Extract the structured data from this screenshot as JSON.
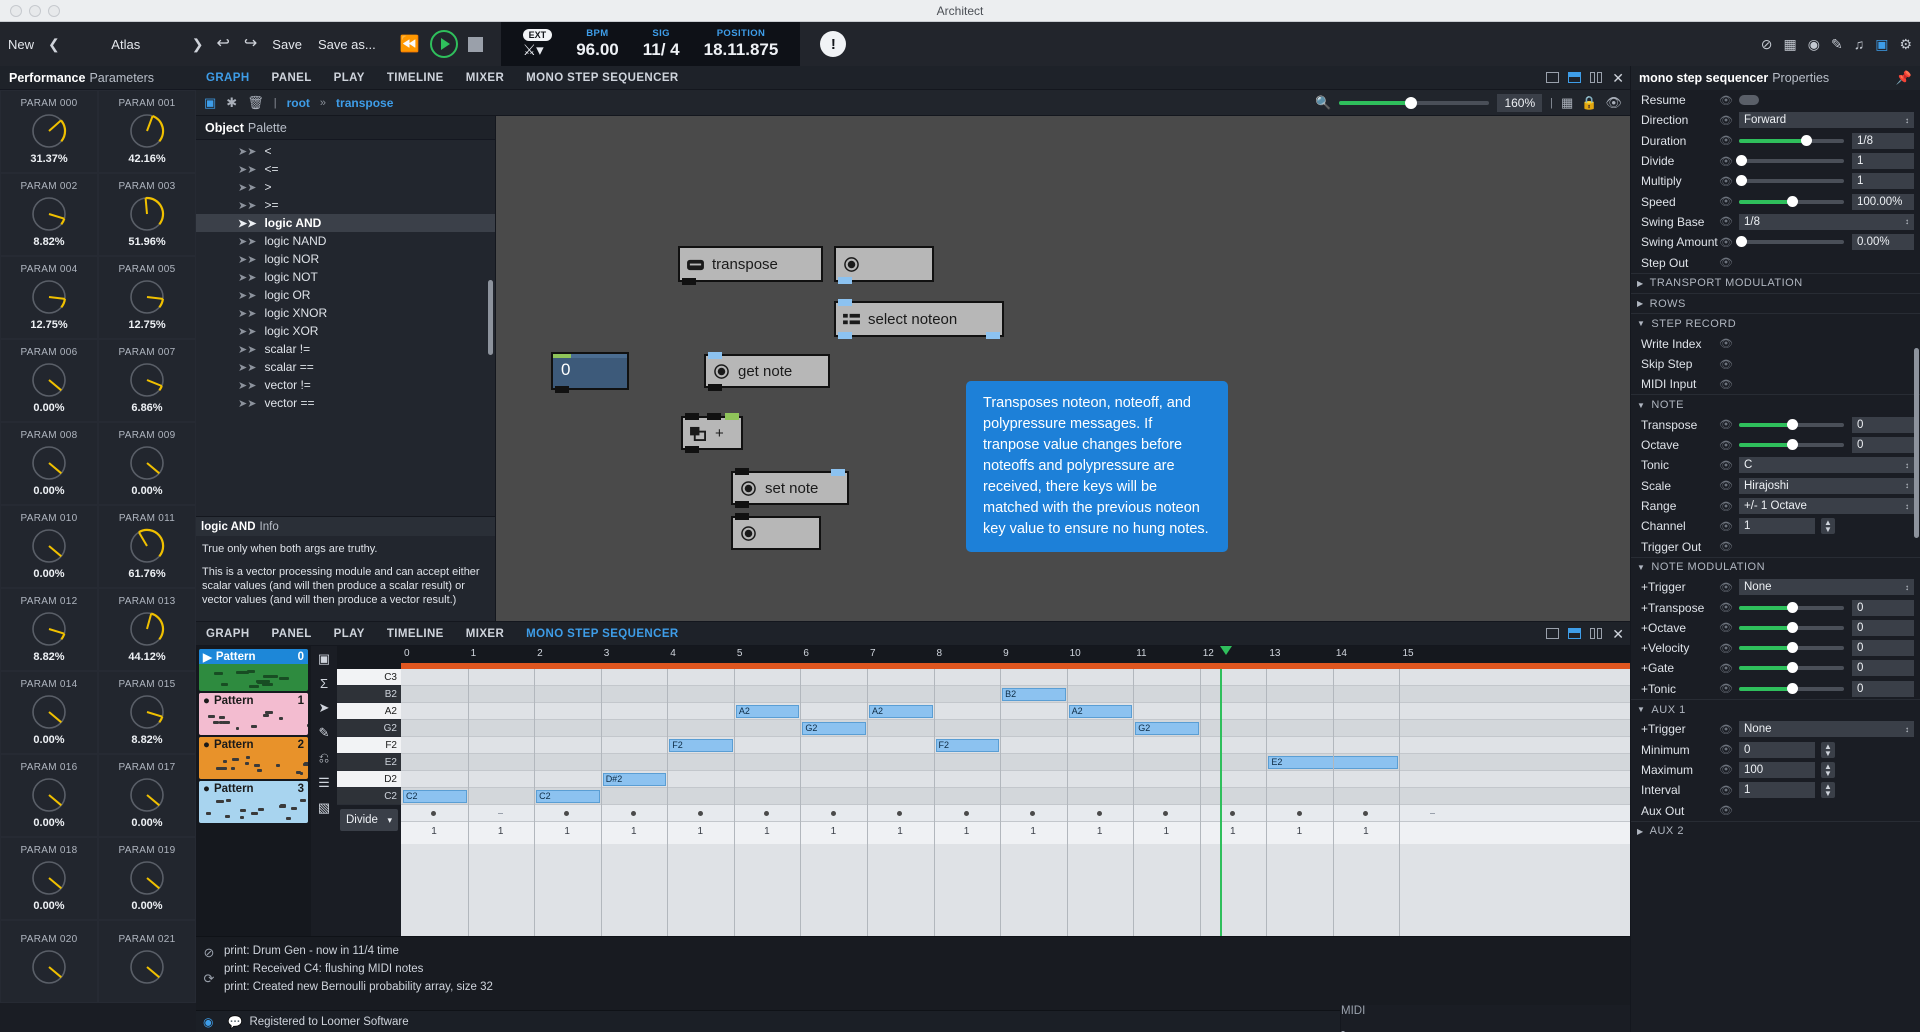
{
  "window": {
    "title": "Architect"
  },
  "toolbar": {
    "new_label": "New",
    "project": "Atlas",
    "save_label": "Save",
    "save_as_label": "Save as...",
    "ext_badge": "EXT",
    "bpm_label": "BPM",
    "bpm_value": "96.00",
    "sig_label": "SIG",
    "sig_num": "11/",
    "sig_den": "4",
    "position_label": "POSITION",
    "position_value": "18.11.875",
    "accent": "#3e9de8",
    "play_color": "#2fbf5c"
  },
  "left_panel": {
    "title_bold": "Performance",
    "title_rest": "Parameters",
    "params": [
      {
        "name": "PARAM 000",
        "value": "31.37%",
        "pct": 31.37
      },
      {
        "name": "PARAM 001",
        "value": "42.16%",
        "pct": 42.16
      },
      {
        "name": "PARAM 002",
        "value": "8.82%",
        "pct": 8.82
      },
      {
        "name": "PARAM 003",
        "value": "51.96%",
        "pct": 51.96
      },
      {
        "name": "PARAM 004",
        "value": "12.75%",
        "pct": 12.75
      },
      {
        "name": "PARAM 005",
        "value": "12.75%",
        "pct": 12.75
      },
      {
        "name": "PARAM 006",
        "value": "0.00%",
        "pct": 0
      },
      {
        "name": "PARAM 007",
        "value": "6.86%",
        "pct": 6.86
      },
      {
        "name": "PARAM 008",
        "value": "0.00%",
        "pct": 0
      },
      {
        "name": "PARAM 009",
        "value": "0.00%",
        "pct": 0
      },
      {
        "name": "PARAM 010",
        "value": "0.00%",
        "pct": 0
      },
      {
        "name": "PARAM 011",
        "value": "61.76%",
        "pct": 61.76
      },
      {
        "name": "PARAM 012",
        "value": "8.82%",
        "pct": 8.82
      },
      {
        "name": "PARAM 013",
        "value": "44.12%",
        "pct": 44.12
      },
      {
        "name": "PARAM 014",
        "value": "0.00%",
        "pct": 0
      },
      {
        "name": "PARAM 015",
        "value": "8.82%",
        "pct": 8.82
      },
      {
        "name": "PARAM 016",
        "value": "0.00%",
        "pct": 0
      },
      {
        "name": "PARAM 017",
        "value": "0.00%",
        "pct": 0
      },
      {
        "name": "PARAM 018",
        "value": "0.00%",
        "pct": 0
      },
      {
        "name": "PARAM 019",
        "value": "0.00%",
        "pct": 0
      },
      {
        "name": "PARAM 020",
        "value": "",
        "pct": 0
      },
      {
        "name": "PARAM 021",
        "value": "",
        "pct": 0
      }
    ]
  },
  "editor_tabs": {
    "items": [
      "GRAPH",
      "PANEL",
      "PLAY",
      "TIMELINE",
      "MIXER",
      "MONO STEP SEQUENCER"
    ],
    "active": "GRAPH"
  },
  "graph_bar": {
    "breadcrumb_root": "root",
    "breadcrumb_sep": "»",
    "breadcrumb_current": "transpose",
    "zoom_value": "160%"
  },
  "palette": {
    "title_bold": "Object",
    "title_rest": "Palette",
    "items": [
      "<",
      "<=",
      ">",
      ">=",
      "logic AND",
      "logic NAND",
      "logic NOR",
      "logic NOT",
      "logic OR",
      "logic XNOR",
      "logic XOR",
      "scalar !=",
      "scalar ==",
      "vector !=",
      "vector =="
    ],
    "selected": "logic AND",
    "info_title_bold": "logic AND",
    "info_title_rest": "Info",
    "info_p1": "True only when both args are truthy.",
    "info_p2": "This is a vector processing module and can accept either scalar values (and will then produce a scalar result) or vector values (and will then produce a vector result.)"
  },
  "canvas": {
    "nodes": [
      {
        "label": "transpose",
        "icon": "inlet-icon"
      },
      {
        "label": "",
        "icon": "dial-icon"
      },
      {
        "label": "select noteon",
        "icon": "list-icon"
      },
      {
        "label": "get note",
        "icon": "dial-icon"
      },
      {
        "label": "+",
        "icon": "stack-icon"
      },
      {
        "label": "set note",
        "icon": "dial-icon"
      },
      {
        "label": "",
        "icon": "dial-icon"
      }
    ],
    "number_box_value": "0",
    "tooltip": "Transposes noteon, noteoff, and polypressure messages. If tranpose value changes before noteoffs and polypressure are received, there keys will be matched with the previous noteon key value to ensure no hung notes."
  },
  "sequencer": {
    "tabs": {
      "items": [
        "GRAPH",
        "PANEL",
        "PLAY",
        "TIMELINE",
        "MIXER",
        "MONO STEP SEQUENCER"
      ],
      "active": "MONO STEP SEQUENCER"
    },
    "patterns": [
      {
        "name": "Pattern",
        "index": "0",
        "color": "#2e8b3f",
        "header": "#1d87d8",
        "playing": true
      },
      {
        "name": "Pattern",
        "index": "1",
        "color": "#f3bcd0",
        "header": "#f3bcd0",
        "playing": false
      },
      {
        "name": "Pattern",
        "index": "2",
        "color": "#e8922a",
        "header": "#e8922a",
        "playing": false
      },
      {
        "name": "Pattern",
        "index": "3",
        "color": "#a8d4ef",
        "header": "#a8d4ef",
        "playing": false
      }
    ],
    "divide_label": "Divide",
    "ruler_labels": [
      "0",
      "1",
      "2",
      "3",
      "4",
      "5",
      "6",
      "7",
      "8",
      "9",
      "10",
      "11",
      "12",
      "13",
      "14",
      "15"
    ],
    "key_labels": [
      "C3",
      "B2",
      "A2",
      "G2",
      "F2",
      "E2",
      "D2",
      "C2"
    ],
    "notes": [
      {
        "key": "B2",
        "start": 9.0,
        "len": 1.0,
        "label": "B2"
      },
      {
        "key": "A2",
        "start": 5.0,
        "len": 1.0,
        "label": "A2"
      },
      {
        "key": "A2",
        "start": 7.0,
        "len": 1.0,
        "label": "A2"
      },
      {
        "key": "A2",
        "start": 10.0,
        "len": 1.0,
        "label": "A2"
      },
      {
        "key": "G2",
        "start": 6.0,
        "len": 1.0,
        "label": "G2"
      },
      {
        "key": "G2",
        "start": 11.0,
        "len": 1.0,
        "label": "G2"
      },
      {
        "key": "F2",
        "start": 4.0,
        "len": 1.0,
        "label": "F2"
      },
      {
        "key": "F2",
        "start": 8.0,
        "len": 1.0,
        "label": "F2"
      },
      {
        "key": "E2",
        "start": 13.0,
        "len": 2.0,
        "label": "E2"
      },
      {
        "key": "D2",
        "start": 3.0,
        "len": 1.0,
        "label": "D#2"
      },
      {
        "key": "C2",
        "start": 0.0,
        "len": 1.0,
        "label": "C2"
      },
      {
        "key": "C2",
        "start": 2.0,
        "len": 1.0,
        "label": "C2"
      }
    ],
    "steps_on": [
      0,
      2,
      3,
      4,
      5,
      6,
      7,
      8,
      9,
      10,
      11,
      12,
      13,
      14
    ],
    "step_values": [
      "1",
      "1",
      "1",
      "1",
      "1",
      "1",
      "1",
      "1",
      "1",
      "1",
      "1",
      "1",
      "1",
      "1",
      "1"
    ]
  },
  "properties": {
    "title_bold": "mono step sequencer",
    "title_rest": "Properties",
    "rows": [
      {
        "label": "Resume",
        "type": "toggle"
      },
      {
        "label": "Direction",
        "type": "select",
        "value": "Forward"
      },
      {
        "label": "Duration",
        "type": "slider",
        "fill": 64,
        "value": "1/8"
      },
      {
        "label": "Divide",
        "type": "slider",
        "fill": 2,
        "value": "1"
      },
      {
        "label": "Multiply",
        "type": "slider",
        "fill": 2,
        "value": "1"
      },
      {
        "label": "Speed",
        "type": "slider",
        "fill": 50,
        "value": "100.00%"
      },
      {
        "label": "Swing Base",
        "type": "select",
        "value": "1/8"
      },
      {
        "label": "Swing Amount",
        "type": "slider",
        "fill": 2,
        "value": "0.00%"
      },
      {
        "label": "Step Out",
        "type": "blank"
      }
    ],
    "sections": [
      {
        "label": "TRANSPORT MODULATION",
        "open": false,
        "rows": []
      },
      {
        "label": "ROWS",
        "open": false,
        "rows": []
      },
      {
        "label": "STEP RECORD",
        "open": true,
        "rows": [
          {
            "label": "Write Index",
            "type": "blank"
          },
          {
            "label": "Skip Step",
            "type": "blank"
          },
          {
            "label": "MIDI Input",
            "type": "blank"
          }
        ]
      },
      {
        "label": "NOTE",
        "open": true,
        "rows": [
          {
            "label": "Transpose",
            "type": "slider",
            "fill": 50,
            "value": "0"
          },
          {
            "label": "Octave",
            "type": "slider",
            "fill": 50,
            "value": "0"
          },
          {
            "label": "Tonic",
            "type": "select",
            "value": "C"
          },
          {
            "label": "Scale",
            "type": "select",
            "value": "Hirajoshi"
          },
          {
            "label": "Range",
            "type": "select",
            "value": "+/- 1 Octave"
          },
          {
            "label": "Channel",
            "type": "spinner",
            "value": "1"
          },
          {
            "label": "Trigger Out",
            "type": "blank"
          }
        ]
      },
      {
        "label": "NOTE MODULATION",
        "open": true,
        "rows": [
          {
            "label": "+Trigger",
            "type": "select",
            "value": "None"
          },
          {
            "label": "+Transpose",
            "type": "slider",
            "fill": 50,
            "value": "0"
          },
          {
            "label": "+Octave",
            "type": "slider",
            "fill": 50,
            "value": "0"
          },
          {
            "label": "+Velocity",
            "type": "slider",
            "fill": 50,
            "value": "0"
          },
          {
            "label": "+Gate",
            "type": "slider",
            "fill": 50,
            "value": "0"
          },
          {
            "label": "+Tonic",
            "type": "slider",
            "fill": 50,
            "value": "0"
          }
        ]
      },
      {
        "label": "AUX 1",
        "open": true,
        "rows": [
          {
            "label": "+Trigger",
            "type": "select",
            "value": "None"
          },
          {
            "label": "Minimum",
            "type": "spinner",
            "value": "0"
          },
          {
            "label": "Maximum",
            "type": "spinner",
            "value": "100"
          },
          {
            "label": "Interval",
            "type": "spinner",
            "value": "1"
          },
          {
            "label": "Aux Out",
            "type": "blank"
          }
        ]
      },
      {
        "label": "AUX 2",
        "open": false,
        "rows": []
      }
    ]
  },
  "console": {
    "lines": [
      "print: Drum Gen - now in 11/4 time",
      "print: Received C4: flushing MIDI notes",
      "print: Created new Bernoulli probability array, size 32"
    ]
  },
  "status": {
    "text": "Registered to Loomer Software",
    "right": [
      "MIDI",
      "▪"
    ]
  }
}
